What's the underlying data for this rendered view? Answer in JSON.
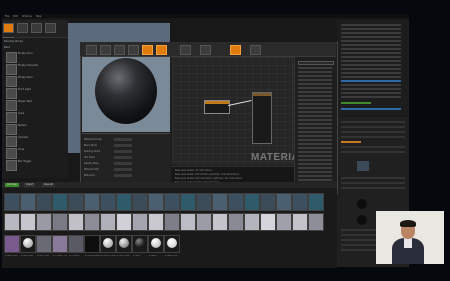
{
  "window": {
    "menu": [
      "File",
      "Edit",
      "Window",
      "Help"
    ]
  },
  "modes_panel": {
    "mode_icons": [
      "place-icon",
      "paint-icon",
      "landscape-icon",
      "foliage-icon",
      "geometry-icon"
    ]
  },
  "place_panel": {
    "categories": [
      "Recently Placed",
      "Basic",
      "Lights",
      "Cinematic",
      "Visual Effects",
      "Geometry",
      "Volumes",
      "All Classes"
    ],
    "items": [
      "Empty Actor",
      "Empty Character",
      "Empty Pawn",
      "Point Light",
      "Player Start",
      "Cube",
      "Sphere",
      "Cylinder",
      "Cone",
      "Box Trigger",
      "Sphere Trigger"
    ]
  },
  "material_editor": {
    "watermark": "MATERIAL",
    "toolbar_icons": [
      "save-icon",
      "find-icon",
      "home-icon",
      "clean-icon",
      "show-icon",
      "apply-icon",
      "search-icon",
      "stats-icon",
      "preview-icon",
      "live-icon"
    ],
    "details_rows": [
      "Material Domain",
      "Blend Mode",
      "Shading Model",
      "Two Sided",
      "Opacity Mask",
      "Dithered LOD",
      "Refraction"
    ],
    "stats_lines": [
      "Base pass shader: 97 instructions",
      "Base pass shader with Surface Lightmap: 124 instructions",
      "Base pass shader with Volumetric Lightmap: 121 instructions",
      "Base pass vertex shader: 34 instructions",
      "Texture samplers: 3/16"
    ]
  },
  "content_browser": {
    "tabs": [
      "Add New",
      "Import",
      "Save All"
    ],
    "assets": [
      {
        "name": "M_Basic_Floor",
        "kind": "material"
      },
      {
        "name": "M_Basic_Wall",
        "kind": "material"
      },
      {
        "name": "M_Brick_Clay",
        "kind": "material"
      },
      {
        "name": "M_Ceramic_Tile",
        "kind": "material"
      },
      {
        "name": "M_Concrete",
        "kind": "material"
      },
      {
        "name": "M_Metal_Brushed",
        "kind": "material"
      },
      {
        "name": "M_Metal_Chrome",
        "kind": "material"
      },
      {
        "name": "M_Metal_Gold",
        "kind": "material"
      },
      {
        "name": "M_Rock",
        "kind": "material"
      },
      {
        "name": "M_Water",
        "kind": "material"
      },
      {
        "name": "M_Wood_Oak",
        "kind": "material"
      }
    ]
  },
  "colors": {
    "accent": "#e07b10",
    "selection": "#2f6aa6",
    "add_new_green": "#3f8b2c"
  }
}
